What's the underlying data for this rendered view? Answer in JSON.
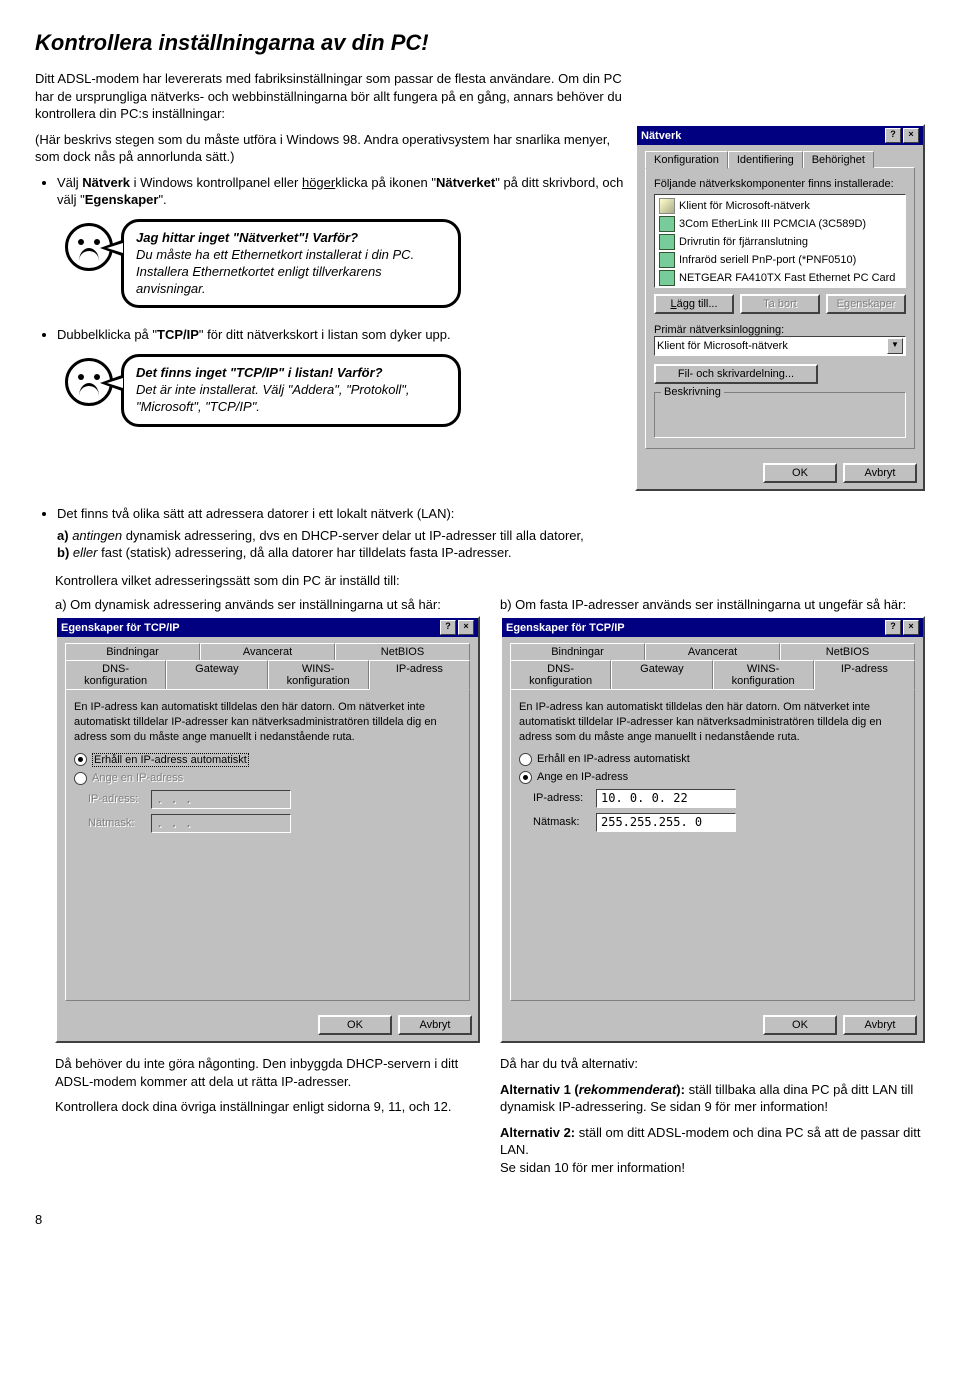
{
  "title": "Kontrollera inställningarna av din PC!",
  "intro_p1": "Ditt ADSL-modem har levererats med fabriksinställningar som passar de flesta användare. Om din PC har de ursprungliga nätverks- och webbinställningarna bör allt fungera på en gång, annars behöver du kontrollera din PC:s inställningar:",
  "intro_p2_pre": "(Här beskrivs stegen som du måste utföra i Windows 98. Andra operativsystem har snarlika menyer, som dock nås på annorlunda sätt.)",
  "bullet1_a": "Välj ",
  "bullet1_b": "Nätverk",
  "bullet1_c": " i Windows kontrollpanel eller ",
  "bullet1_d": "höger",
  "bullet1_e": "klicka på ikonen \"",
  "bullet1_f": "Nätverket",
  "bullet1_g": "\" på ditt skrivbord, och välj \"",
  "bullet1_h": "Egenskaper",
  "bullet1_i": "\".",
  "bubble1_l1": "Jag hittar inget \"Nätverket\"! Varför?",
  "bubble1_l2": "Du måste ha ett Ethernetkort installerat i din PC. Installera Ethernetkortet enligt tillverkarens anvisningar.",
  "bullet2_a": "Dubbelklicka på \"",
  "bullet2_b": "TCP/IP",
  "bullet2_c": "\" för ditt nätverkskort i listan som dyker upp.",
  "bubble2_l1": "Det finns inget \"TCP/IP\" i listan! Varför?",
  "bubble2_l2": "Det är inte installerat. Välj \"Addera\", \"Protokoll\", \"Microsoft\", \"TCP/IP\".",
  "lan_intro": "Det finns två olika sätt att adressera datorer i ett lokalt nätverk (LAN):",
  "lan_a_label": "a)",
  "lan_a_em": "antingen",
  "lan_a_rest": " dynamisk adressering, dvs en DHCP-server delar ut IP-adresser till alla datorer,",
  "lan_b_label": "b)",
  "lan_b_em": "eller",
  "lan_b_rest": " fast (statisk) adressering, då alla datorer har tilldelats fasta IP-adresser.",
  "kontrollera": "Kontrollera vilket adresseringssätt som din PC är inställd till:",
  "col_a_title": "a) Om dynamisk adressering används ser inställningarna ut så här:",
  "col_b_title": "b) Om fasta IP-adresser används ser inställningarna ut ungefär så här:",
  "col_a_bottom": "Då behöver du inte göra någonting. Den inbyggda DHCP-servern i ditt ADSL-modem kommer att dela ut rätta IP-adresser.",
  "col_a_bottom2": "Kontrollera dock dina övriga inställningar enligt sidorna 9, 11, och 12.",
  "col_b_bottom1": "Då har du två alternativ:",
  "col_b_alt1_a": "Alternativ 1 (",
  "col_b_alt1_b": "rekommenderat",
  "col_b_alt1_c": "):",
  "col_b_alt1_rest": " ställ tillbaka alla dina PC på ditt LAN till dynamisk IP-adressering. Se sidan 9 för mer information!",
  "col_b_alt2_a": "Alternativ 2:",
  "col_b_alt2_rest": " ställ om ditt ADSL-modem och dina PC så att de passar ditt LAN.",
  "col_b_alt2_rest2": "Se sidan 10 för mer information!",
  "page": "8",
  "win_natverk": {
    "title": "Nätverk",
    "tabs": [
      "Konfiguration",
      "Identifiering",
      "Behörighet"
    ],
    "label1": "Följande nätverkskomponenter finns installerade:",
    "items": [
      "Klient för Microsoft-nätverk",
      "3Com EtherLink III PCMCIA (3C589D)",
      "Drivrutin för fjärranslutning",
      "Infraröd seriell PnP-port (*PNF0510)",
      "NETGEAR FA410TX Fast Ethernet PC Card"
    ],
    "btn_add": "Lägg till...",
    "btn_remove": "Ta bort",
    "btn_props": "Egenskaper",
    "label2": "Primär nätverksinloggning:",
    "combo": "Klient för Microsoft-nätverk",
    "btn_share": "Fil- och skrivardelning...",
    "group": "Beskrivning",
    "ok": "OK",
    "cancel": "Avbryt"
  },
  "tcpip_a": {
    "title": "Egenskaper för TCP/IP",
    "tabs1": [
      "Bindningar",
      "Avancerat",
      "NetBIOS"
    ],
    "tabs2": [
      "DNS-konfiguration",
      "Gateway",
      "WINS-konfiguration",
      "IP-adress"
    ],
    "desc": "En IP-adress kan automatiskt tilldelas den här datorn. Om nätverket inte automatiskt tilldelar IP-adresser kan nätverksadministratören tilldela dig en adress som du måste ange manuellt i nedanstående ruta.",
    "r1": "Erhåll en IP-adress automatiskt",
    "r2": "Ange en IP-adress",
    "ip_lbl": "IP-adress:",
    "mask_lbl": "Nätmask:",
    "ip_val": ".   .   .",
    "mask_val": ".   .   .",
    "ok": "OK",
    "cancel": "Avbryt"
  },
  "tcpip_b": {
    "title": "Egenskaper för TCP/IP",
    "tabs1": [
      "Bindningar",
      "Avancerat",
      "NetBIOS"
    ],
    "tabs2": [
      "DNS-konfiguration",
      "Gateway",
      "WINS-konfiguration",
      "IP-adress"
    ],
    "desc": "En IP-adress kan automatiskt tilldelas den här datorn. Om nätverket inte automatiskt tilldelar IP-adresser kan nätverksadministratören tilldela dig en adress som du måste ange manuellt i nedanstående ruta.",
    "r1": "Erhåll en IP-adress automatiskt",
    "r2": "Ange en IP-adress",
    "ip_lbl": "IP-adress:",
    "mask_lbl": "Nätmask:",
    "ip_val": "10.  0.  0. 22",
    "mask_val": "255.255.255.  0",
    "ok": "OK",
    "cancel": "Avbryt"
  }
}
